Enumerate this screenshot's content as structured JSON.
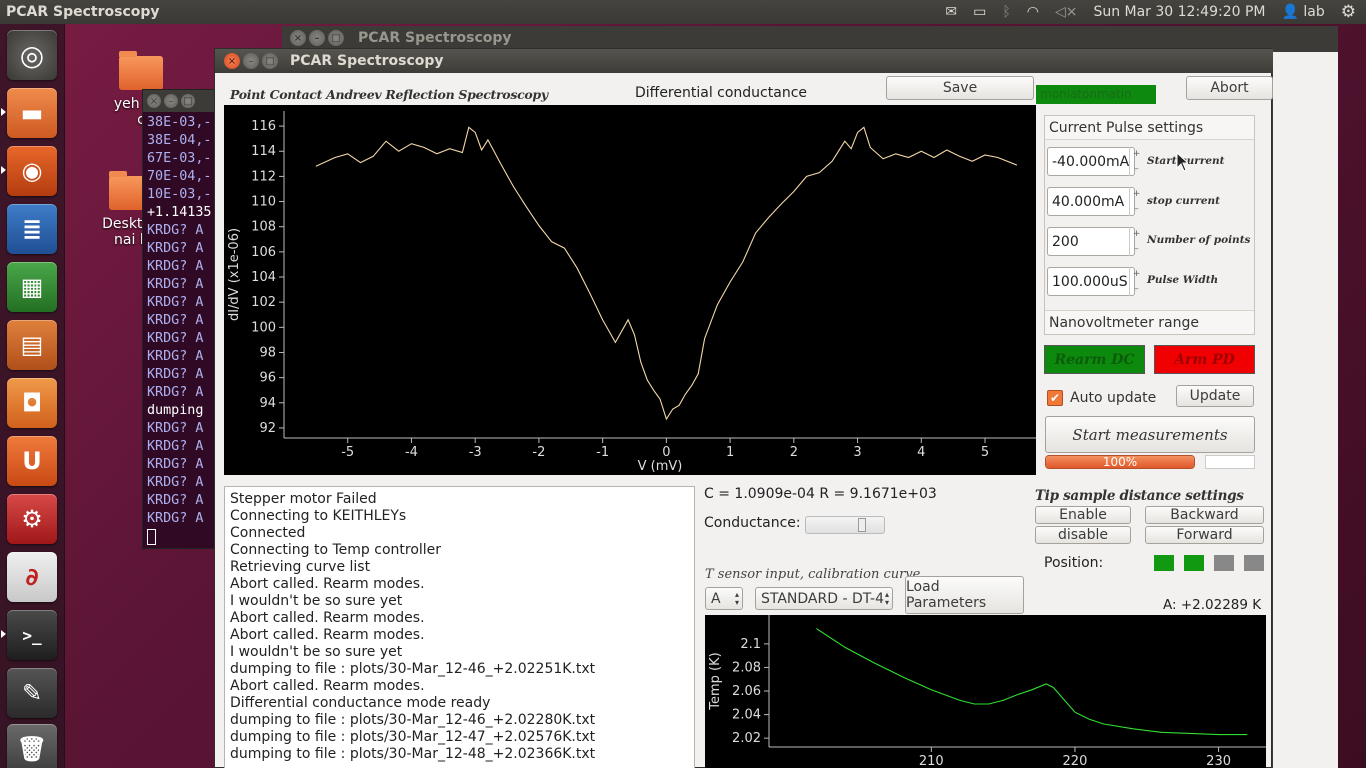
{
  "topbar": {
    "app_title": "PCAR Spectroscopy",
    "clock": "Sun Mar 30 12:49:20 PM",
    "user": "lab"
  },
  "desktop": {
    "icon1_label_line1": "yeh kac",
    "icon1_label_line2": "c",
    "icon2_label_line1": "Desktop",
    "icon2_label_line2": "nai k"
  },
  "bg_window": {
    "title": "PCAR Spectroscopy"
  },
  "terminal": {
    "lines": [
      "38E-03,-",
      "38E-04,-",
      "67E-03,-",
      "70E-04,-",
      "10E-03,-",
      "+1.14135",
      "KRDG? A",
      "KRDG? A",
      "KRDG? A",
      "KRDG? A",
      "KRDG? A",
      "KRDG? A",
      "KRDG? A",
      "KRDG? A",
      "KRDG? A",
      "KRDG? A",
      "dumping",
      "KRDG? A",
      "KRDG? A",
      "KRDG? A",
      "KRDG? A",
      "KRDG? A",
      "KRDG? A"
    ],
    "white_lines": [
      5,
      16
    ]
  },
  "window": {
    "title": "PCAR Spectroscopy"
  },
  "header": {
    "app_heading": "Point Contact Andreev Reflection Spectroscopy",
    "plot_title": "Differential conductance",
    "save_label": "Save",
    "abort_label": "Abort",
    "status_box_text": "moniatonmatin"
  },
  "pulse": {
    "section_label": "Current Pulse settings",
    "start_current_value": "-40.000mA",
    "start_current_label": "Start current",
    "stop_current_value": "40.000mA",
    "stop_current_label": "stop current",
    "num_points_value": "200",
    "num_points_label": "Number of points",
    "pulse_width_value": "100.000uS",
    "pulse_width_label": "Pulse Width",
    "nanovolt_label": "Nanovoltmeter range"
  },
  "arm": {
    "rearm_dc_label": "Rearm DC",
    "arm_pd_label": "Arm PD",
    "rearm_color": "#0d8a0d",
    "arm_pd_color": "#f00000"
  },
  "controls": {
    "auto_update_label": "Auto update",
    "auto_update_checked": true,
    "update_label": "Update",
    "start_label": "Start measurements",
    "progress_text": "100%",
    "progress_value": 1.0
  },
  "cr_readout": "C = 1.0909e-04 R = 9.1671e+03",
  "conductance_label": "Conductance:",
  "tip": {
    "heading": "Tip sample distance settings",
    "enable": "Enable",
    "backward": "Backward",
    "disable": "disable",
    "forward": "Forward",
    "position_label": "Position:",
    "position_colors": [
      "#119911",
      "#119911",
      "#888888",
      "#888888"
    ]
  },
  "tsensor": {
    "label": "T sensor input, calibration curve",
    "channel": "A",
    "curve": "STANDARD - DT-4",
    "load_label": "Load Parameters",
    "reading": "A: +2.02289 K"
  },
  "log": [
    "Stepper motor Failed",
    "Connecting to KEITHLEYs",
    "Connected",
    "Connecting to Temp controller",
    "Retrieving curve list",
    "Abort called.  Rearm modes.",
    "I wouldn't be so sure yet",
    "Abort called.  Rearm modes.",
    "Abort called.  Rearm modes.",
    "I wouldn't be so sure yet",
    "dumping to file : plots/30-Mar_12-46_+2.02251K.txt",
    "Abort called.  Rearm modes.",
    "Differential conductance mode ready",
    "dumping to file : plots/30-Mar_12-46_+2.02280K.txt",
    "dumping to file : plots/30-Mar_12-47_+2.02576K.txt",
    "dumping to file : plots/30-Mar_12-48_+2.02366K.txt"
  ],
  "chart_data": [
    {
      "type": "line",
      "xlabel": "V (mV)",
      "ylabel": "dI/dV (x1e-06)",
      "xlim": [
        -6.0,
        5.8
      ],
      "ylim": [
        91.2,
        117.2
      ],
      "xticks": [
        -5,
        -4,
        -3,
        -2,
        -1,
        0,
        1,
        2,
        3,
        4,
        5
      ],
      "yticks": [
        92,
        94,
        96,
        98,
        100,
        102,
        104,
        106,
        108,
        110,
        112,
        114,
        116
      ],
      "line_color": "#f4d7a8",
      "x": [
        -5.5,
        -5.2,
        -5.0,
        -4.8,
        -4.6,
        -4.4,
        -4.2,
        -4.0,
        -3.8,
        -3.6,
        -3.4,
        -3.2,
        -3.1,
        -3.0,
        -2.9,
        -2.8,
        -2.6,
        -2.4,
        -2.2,
        -2.0,
        -1.8,
        -1.6,
        -1.4,
        -1.2,
        -1.0,
        -0.8,
        -0.6,
        -0.5,
        -0.4,
        -0.3,
        -0.2,
        -0.1,
        0.0,
        0.1,
        0.2,
        0.3,
        0.4,
        0.5,
        0.6,
        0.8,
        1.0,
        1.2,
        1.4,
        1.6,
        1.8,
        2.0,
        2.2,
        2.4,
        2.6,
        2.8,
        2.9,
        3.0,
        3.1,
        3.2,
        3.4,
        3.6,
        3.8,
        4.0,
        4.2,
        4.4,
        4.6,
        4.8,
        5.0,
        5.2,
        5.5
      ],
      "y": [
        112.8,
        113.5,
        113.8,
        113.1,
        113.6,
        114.8,
        114.0,
        114.6,
        114.3,
        113.8,
        114.2,
        113.9,
        115.9,
        115.5,
        114.1,
        114.9,
        113.0,
        111.2,
        109.6,
        108.1,
        106.8,
        106.3,
        104.7,
        102.7,
        100.6,
        98.8,
        100.6,
        99.4,
        97.2,
        95.8,
        95.0,
        94.3,
        92.7,
        93.5,
        93.8,
        94.7,
        95.4,
        96.3,
        99.1,
        101.8,
        103.6,
        105.2,
        107.5,
        108.7,
        109.8,
        110.8,
        112.0,
        112.3,
        113.2,
        114.8,
        114.2,
        115.5,
        115.9,
        114.3,
        113.4,
        113.8,
        113.5,
        114.0,
        113.5,
        114.1,
        113.6,
        113.2,
        113.7,
        113.5,
        112.9
      ]
    },
    {
      "type": "line",
      "xlabel": "",
      "ylabel": "Temp (K)",
      "xlim": [
        198.7,
        233.3
      ],
      "ylim": [
        2.0125,
        2.1245
      ],
      "xticks": [
        210,
        220,
        230
      ],
      "yticks": [
        2.02,
        2.04,
        2.06,
        2.08,
        2.1
      ],
      "line_color": "#30e030",
      "x": [
        202,
        204,
        206,
        208,
        210,
        212,
        213,
        214,
        215,
        216,
        217,
        218,
        218.5,
        219,
        220,
        221,
        222,
        224,
        226,
        228,
        230,
        232
      ],
      "y": [
        2.113,
        2.097,
        2.084,
        2.072,
        2.061,
        2.052,
        2.049,
        2.049,
        2.052,
        2.057,
        2.061,
        2.066,
        2.063,
        2.056,
        2.042,
        2.036,
        2.032,
        2.028,
        2.025,
        2.024,
        2.023,
        2.023
      ]
    }
  ]
}
